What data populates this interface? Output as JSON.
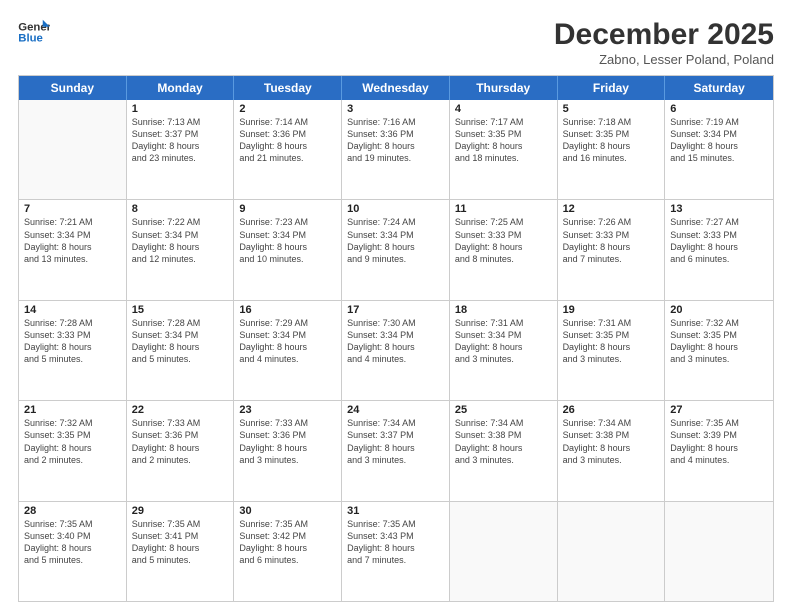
{
  "header": {
    "logo_line1": "General",
    "logo_line2": "Blue",
    "title": "December 2025",
    "subtitle": "Zabno, Lesser Poland, Poland"
  },
  "weekdays": [
    "Sunday",
    "Monday",
    "Tuesday",
    "Wednesday",
    "Thursday",
    "Friday",
    "Saturday"
  ],
  "rows": [
    [
      {
        "day": "",
        "lines": []
      },
      {
        "day": "1",
        "lines": [
          "Sunrise: 7:13 AM",
          "Sunset: 3:37 PM",
          "Daylight: 8 hours",
          "and 23 minutes."
        ]
      },
      {
        "day": "2",
        "lines": [
          "Sunrise: 7:14 AM",
          "Sunset: 3:36 PM",
          "Daylight: 8 hours",
          "and 21 minutes."
        ]
      },
      {
        "day": "3",
        "lines": [
          "Sunrise: 7:16 AM",
          "Sunset: 3:36 PM",
          "Daylight: 8 hours",
          "and 19 minutes."
        ]
      },
      {
        "day": "4",
        "lines": [
          "Sunrise: 7:17 AM",
          "Sunset: 3:35 PM",
          "Daylight: 8 hours",
          "and 18 minutes."
        ]
      },
      {
        "day": "5",
        "lines": [
          "Sunrise: 7:18 AM",
          "Sunset: 3:35 PM",
          "Daylight: 8 hours",
          "and 16 minutes."
        ]
      },
      {
        "day": "6",
        "lines": [
          "Sunrise: 7:19 AM",
          "Sunset: 3:34 PM",
          "Daylight: 8 hours",
          "and 15 minutes."
        ]
      }
    ],
    [
      {
        "day": "7",
        "lines": [
          "Sunrise: 7:21 AM",
          "Sunset: 3:34 PM",
          "Daylight: 8 hours",
          "and 13 minutes."
        ]
      },
      {
        "day": "8",
        "lines": [
          "Sunrise: 7:22 AM",
          "Sunset: 3:34 PM",
          "Daylight: 8 hours",
          "and 12 minutes."
        ]
      },
      {
        "day": "9",
        "lines": [
          "Sunrise: 7:23 AM",
          "Sunset: 3:34 PM",
          "Daylight: 8 hours",
          "and 10 minutes."
        ]
      },
      {
        "day": "10",
        "lines": [
          "Sunrise: 7:24 AM",
          "Sunset: 3:34 PM",
          "Daylight: 8 hours",
          "and 9 minutes."
        ]
      },
      {
        "day": "11",
        "lines": [
          "Sunrise: 7:25 AM",
          "Sunset: 3:33 PM",
          "Daylight: 8 hours",
          "and 8 minutes."
        ]
      },
      {
        "day": "12",
        "lines": [
          "Sunrise: 7:26 AM",
          "Sunset: 3:33 PM",
          "Daylight: 8 hours",
          "and 7 minutes."
        ]
      },
      {
        "day": "13",
        "lines": [
          "Sunrise: 7:27 AM",
          "Sunset: 3:33 PM",
          "Daylight: 8 hours",
          "and 6 minutes."
        ]
      }
    ],
    [
      {
        "day": "14",
        "lines": [
          "Sunrise: 7:28 AM",
          "Sunset: 3:33 PM",
          "Daylight: 8 hours",
          "and 5 minutes."
        ]
      },
      {
        "day": "15",
        "lines": [
          "Sunrise: 7:28 AM",
          "Sunset: 3:34 PM",
          "Daylight: 8 hours",
          "and 5 minutes."
        ]
      },
      {
        "day": "16",
        "lines": [
          "Sunrise: 7:29 AM",
          "Sunset: 3:34 PM",
          "Daylight: 8 hours",
          "and 4 minutes."
        ]
      },
      {
        "day": "17",
        "lines": [
          "Sunrise: 7:30 AM",
          "Sunset: 3:34 PM",
          "Daylight: 8 hours",
          "and 4 minutes."
        ]
      },
      {
        "day": "18",
        "lines": [
          "Sunrise: 7:31 AM",
          "Sunset: 3:34 PM",
          "Daylight: 8 hours",
          "and 3 minutes."
        ]
      },
      {
        "day": "19",
        "lines": [
          "Sunrise: 7:31 AM",
          "Sunset: 3:35 PM",
          "Daylight: 8 hours",
          "and 3 minutes."
        ]
      },
      {
        "day": "20",
        "lines": [
          "Sunrise: 7:32 AM",
          "Sunset: 3:35 PM",
          "Daylight: 8 hours",
          "and 3 minutes."
        ]
      }
    ],
    [
      {
        "day": "21",
        "lines": [
          "Sunrise: 7:32 AM",
          "Sunset: 3:35 PM",
          "Daylight: 8 hours",
          "and 2 minutes."
        ]
      },
      {
        "day": "22",
        "lines": [
          "Sunrise: 7:33 AM",
          "Sunset: 3:36 PM",
          "Daylight: 8 hours",
          "and 2 minutes."
        ]
      },
      {
        "day": "23",
        "lines": [
          "Sunrise: 7:33 AM",
          "Sunset: 3:36 PM",
          "Daylight: 8 hours",
          "and 3 minutes."
        ]
      },
      {
        "day": "24",
        "lines": [
          "Sunrise: 7:34 AM",
          "Sunset: 3:37 PM",
          "Daylight: 8 hours",
          "and 3 minutes."
        ]
      },
      {
        "day": "25",
        "lines": [
          "Sunrise: 7:34 AM",
          "Sunset: 3:38 PM",
          "Daylight: 8 hours",
          "and 3 minutes."
        ]
      },
      {
        "day": "26",
        "lines": [
          "Sunrise: 7:34 AM",
          "Sunset: 3:38 PM",
          "Daylight: 8 hours",
          "and 3 minutes."
        ]
      },
      {
        "day": "27",
        "lines": [
          "Sunrise: 7:35 AM",
          "Sunset: 3:39 PM",
          "Daylight: 8 hours",
          "and 4 minutes."
        ]
      }
    ],
    [
      {
        "day": "28",
        "lines": [
          "Sunrise: 7:35 AM",
          "Sunset: 3:40 PM",
          "Daylight: 8 hours",
          "and 5 minutes."
        ]
      },
      {
        "day": "29",
        "lines": [
          "Sunrise: 7:35 AM",
          "Sunset: 3:41 PM",
          "Daylight: 8 hours",
          "and 5 minutes."
        ]
      },
      {
        "day": "30",
        "lines": [
          "Sunrise: 7:35 AM",
          "Sunset: 3:42 PM",
          "Daylight: 8 hours",
          "and 6 minutes."
        ]
      },
      {
        "day": "31",
        "lines": [
          "Sunrise: 7:35 AM",
          "Sunset: 3:43 PM",
          "Daylight: 8 hours",
          "and 7 minutes."
        ]
      },
      {
        "day": "",
        "lines": []
      },
      {
        "day": "",
        "lines": []
      },
      {
        "day": "",
        "lines": []
      }
    ]
  ]
}
